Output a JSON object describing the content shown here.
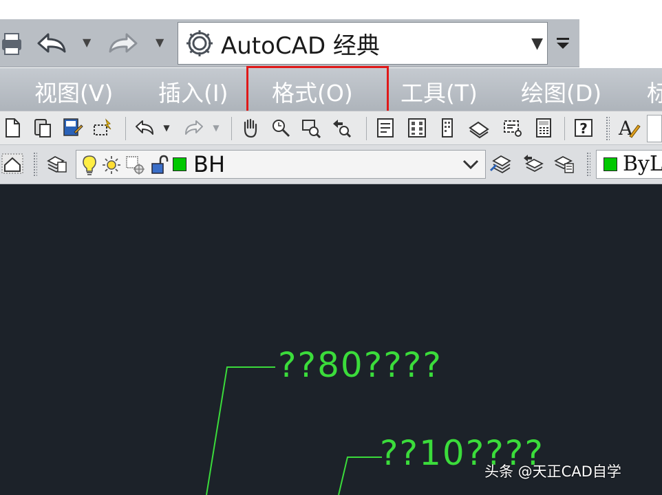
{
  "quick_access": {
    "workspace": "AutoCAD 经典",
    "icons": [
      "print-icon",
      "undo-icon",
      "redo-icon",
      "gear-icon",
      "chevron-down-icon"
    ]
  },
  "menu": {
    "items": [
      "视图(V)",
      "插入(I)",
      "格式(O)",
      "工具(T)",
      "绘图(D)",
      "标"
    ],
    "highlighted": "格式(O)"
  },
  "toolbar_standard": {
    "icons": [
      "new-icon",
      "paste-icon",
      "match-properties-icon",
      "block-editor-icon",
      "undo-icon",
      "redo-icon",
      "pan-icon",
      "zoom-realtime-icon",
      "zoom-window-icon",
      "zoom-previous-icon",
      "properties-icon",
      "design-center-icon",
      "tool-palettes-icon",
      "sheet-set-icon",
      "markup-icon",
      "calculator-icon",
      "help-icon",
      "text-style-icon"
    ]
  },
  "toolbar_layers": {
    "current_layer": "BH",
    "color_value": "ByL",
    "layer_color": "#00c800"
  },
  "drawing": {
    "label_1": "??80????",
    "label_2": "??10????",
    "line_color": "#3bdc3b",
    "background": "#1c2229"
  },
  "watermark": {
    "text": "头条 @天正CAD自学"
  }
}
